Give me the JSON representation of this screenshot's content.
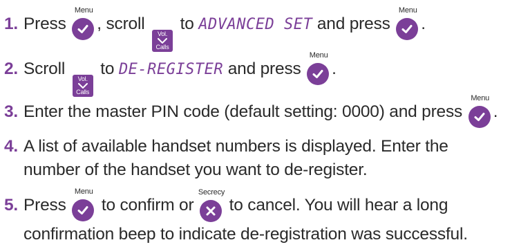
{
  "steps": [
    {
      "num": "1.",
      "press": "Press",
      "scroll": ", scroll",
      "to": "to",
      "lcd": "ADVANCED SET",
      "and_press": "and press",
      "end": "."
    },
    {
      "num": "2.",
      "scroll": "Scroll",
      "to": "to",
      "lcd": "DE-REGISTER",
      "and_press": "and press",
      "end": "."
    },
    {
      "num": "3.",
      "text": "Enter the master PIN code (default setting: 0000) and press",
      "end": "."
    },
    {
      "num": "4.",
      "line1": "A list of available handset numbers is displayed. Enter the",
      "line2": "number of the handset you want to de-register."
    },
    {
      "num": "5.",
      "press": "Press",
      "confirm": "to confirm or",
      "cancel": "to cancel. You will hear a long",
      "line2": "confirmation beep to indicate de-registration was successful."
    }
  ],
  "keys": {
    "menu_caption": "Menu",
    "secrecy_caption": "Secrecy",
    "vol_top": "Vol.",
    "vol_bottom": "Calls"
  },
  "icons": {
    "menu_key": "checkmark-icon",
    "secrecy_key": "cross-icon",
    "vol_calls_key": "chevron-down-icon"
  },
  "colors": {
    "accent": "#7b3f98",
    "text": "#2a2a2a"
  }
}
